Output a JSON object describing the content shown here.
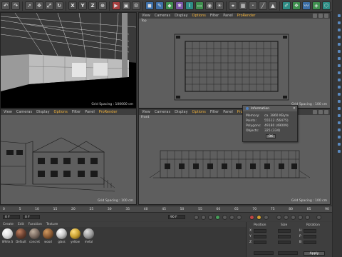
{
  "toolbar": {
    "items": [
      {
        "icon": "undo-icon"
      },
      {
        "icon": "redo-icon"
      },
      {
        "icon": "select-icon"
      },
      {
        "icon": "move-icon"
      },
      {
        "icon": "scale-icon"
      },
      {
        "icon": "rotate-icon"
      },
      {
        "icon": "x-axis-icon",
        "label": "X"
      },
      {
        "icon": "y-axis-icon",
        "label": "Y"
      },
      {
        "icon": "z-axis-icon",
        "label": "Z"
      },
      {
        "icon": "coordinate-system-icon"
      }
    ]
  },
  "viewports": {
    "perspective": {
      "menu": [
        "View",
        "Cameras",
        "Display",
        "Options",
        "Filter",
        "Panel",
        "ProRender"
      ],
      "grid_spacing": "Grid Spacing : 100000 cm"
    },
    "top": {
      "name": "Top",
      "menu": [
        "View",
        "Cameras",
        "Display",
        "Options",
        "Filter",
        "Panel",
        "ProRender"
      ],
      "grid_spacing": "Grid Spacing : 100 cm"
    },
    "right": {
      "menu": [
        "View",
        "Cameras",
        "Display",
        "Options",
        "Filter",
        "Panel",
        "ProRender"
      ],
      "grid_spacing": "Grid Spacing : 100 cm"
    },
    "front": {
      "name": "Front",
      "menu": [
        "View",
        "Cameras",
        "Display",
        "Options",
        "Filter",
        "Panel",
        "ProRender"
      ],
      "grid_spacing": "Grid Spacing : 100 cm"
    }
  },
  "info_dialog": {
    "title": "Information",
    "rows": [
      {
        "k": "Memory:",
        "v": "ca. 3860 KByte"
      },
      {
        "k": "Points:",
        "v": "55512 (56475)"
      },
      {
        "k": "Polygons:",
        "v": "49180 (49009)"
      },
      {
        "k": "Objects:",
        "v": "325 (334)"
      }
    ],
    "ok": "OK"
  },
  "timeline": {
    "ticks": [
      "0",
      "5",
      "10",
      "15",
      "20",
      "25",
      "30",
      "35",
      "40",
      "45",
      "50",
      "55",
      "60",
      "65",
      "70",
      "75",
      "80",
      "85",
      "90"
    ],
    "start_field": "0 F",
    "end_field": "90 F",
    "current_field": "0 F"
  },
  "materials": {
    "menu": [
      "Create",
      "Edit",
      "Function",
      "Texture"
    ],
    "items": [
      {
        "label": "White.S",
        "color": "#e6e6e6"
      },
      {
        "label": "Default",
        "color": "#6a4030"
      },
      {
        "label": "concret",
        "color": "#7a6a60"
      },
      {
        "label": "wood",
        "color": "#8a5a34"
      },
      {
        "label": "glass",
        "color": "#c8c8c8"
      },
      {
        "label": "yellow",
        "color": "#c8a030"
      },
      {
        "label": "metal",
        "color": "#9a9a9a"
      },
      {
        "label": "black",
        "color": "#4a4a4a"
      }
    ]
  },
  "coords": {
    "headers": [
      "Position",
      "Size",
      "Rotation"
    ],
    "rows": [
      {
        "axis": "X",
        "v1": "0 cm",
        "v2": "0 cm",
        "axis2": "H",
        "v3": "0°"
      },
      {
        "axis": "Y",
        "v1": "0 cm",
        "v2": "0 cm",
        "axis2": "P",
        "v3": "0°"
      },
      {
        "axis": "Z",
        "v1": "0 cm",
        "v2": "0 cm",
        "axis2": "B",
        "v3": "0°"
      }
    ],
    "mode_object": "Object (Rel)",
    "mode_size": "Size",
    "apply": "Apply"
  }
}
